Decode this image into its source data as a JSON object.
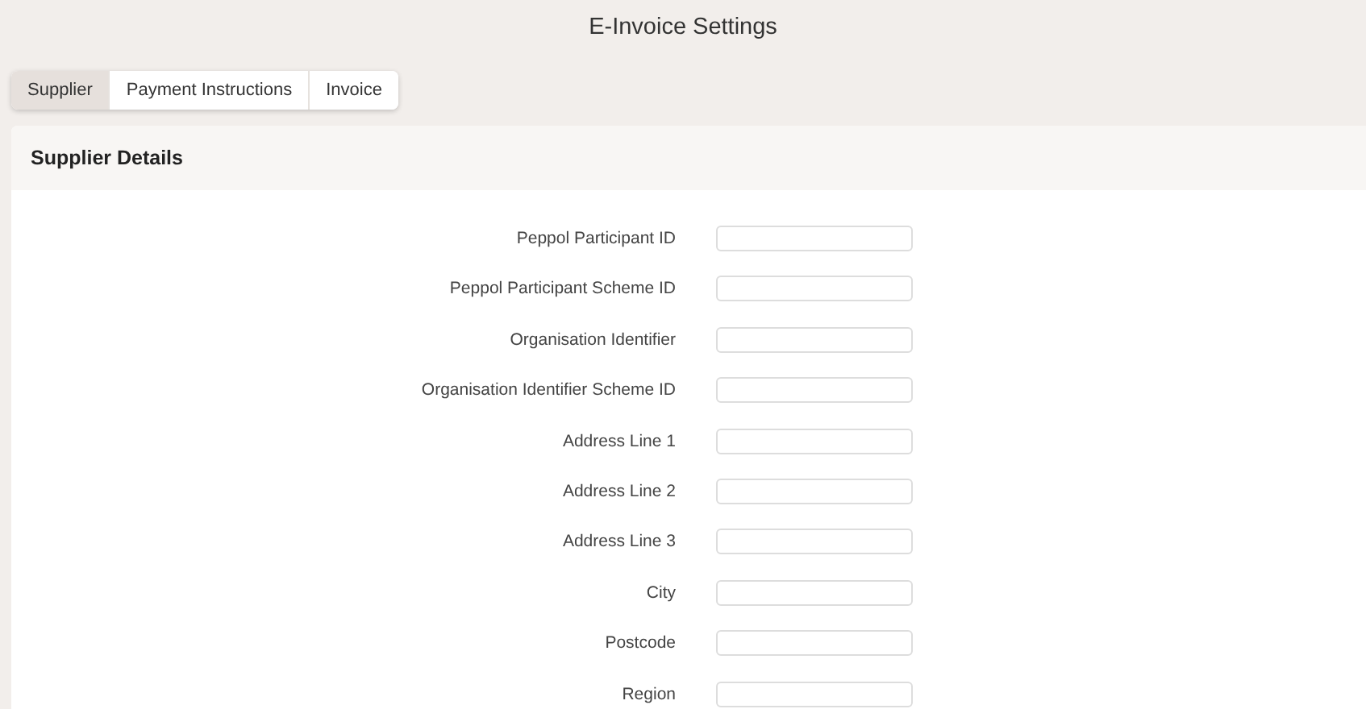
{
  "window": {
    "title": "E-Invoice Settings"
  },
  "tabs": [
    {
      "label": "Supplier",
      "selected": true
    },
    {
      "label": "Payment Instructions",
      "selected": false
    },
    {
      "label": "Invoice",
      "selected": false
    }
  ],
  "section": {
    "title": "Supplier Details"
  },
  "fields": [
    {
      "label": "Peppol Participant ID"
    },
    {
      "label": "Peppol Participant Scheme ID"
    },
    {
      "label": "Organisation Identifier"
    },
    {
      "label": "Organisation Identifier Scheme ID"
    },
    {
      "label": "Address Line 1"
    },
    {
      "label": "Address Line 2"
    },
    {
      "label": "Address Line 3"
    },
    {
      "label": "City"
    },
    {
      "label": "Postcode"
    },
    {
      "label": "Region"
    }
  ]
}
